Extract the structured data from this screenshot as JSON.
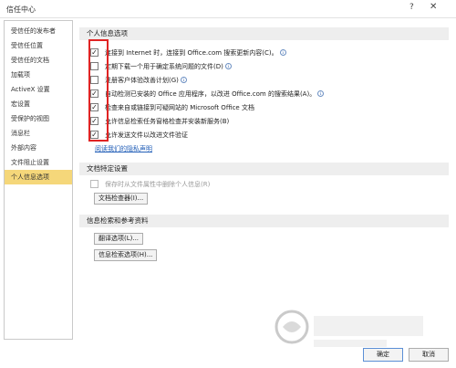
{
  "window": {
    "title": "信任中心",
    "help_glyph": "?",
    "close_glyph": "✕"
  },
  "sidebar": {
    "items": [
      {
        "label": "受信任的发布者"
      },
      {
        "label": "受信任位置"
      },
      {
        "label": "受信任的文档"
      },
      {
        "label": "加载项"
      },
      {
        "label": "ActiveX 设置"
      },
      {
        "label": "宏设置"
      },
      {
        "label": "受保护的视图"
      },
      {
        "label": "消息栏"
      },
      {
        "label": "外部内容"
      },
      {
        "label": "文件阻止设置"
      },
      {
        "label": "个人信息选项"
      }
    ],
    "active_index": 10
  },
  "privacy": {
    "header": "个人信息选项",
    "options": [
      {
        "label": "连接到 Internet 时，连接到 Office.com 搜索更新内容(C)。",
        "checked": true
      },
      {
        "label": "定期下载一个用于确定系统问题的文件(D)",
        "checked": false
      },
      {
        "label": "注册客户体验改善计划(G)",
        "checked": false
      },
      {
        "label": "自动检测已安装的 Office 应用程序，以改进 Office.com 的搜索结果(A)。",
        "checked": true
      },
      {
        "label": "检查来自或链接到可疑网站的 Microsoft Office 文档",
        "checked": true
      },
      {
        "label": "允许信息检索任务窗格检查并安装新服务(B)",
        "checked": true
      },
      {
        "label": "允许发送文件以改进文件验证",
        "checked": true
      }
    ],
    "privacy_link": "阅读我们的隐私声明"
  },
  "doc_specific": {
    "header": "文档特定设置",
    "option": {
      "label": "保存时从文件属性中删除个人信息(R)",
      "checked": false
    },
    "inspector_button": "文档检查器(I)..."
  },
  "research": {
    "header": "信息检索和参考资料",
    "translate_button": "翻译选项(L)...",
    "research_button": "信息检索选项(H)..."
  },
  "footer": {
    "ok_label": "确定",
    "cancel_label": "取消"
  },
  "colors": {
    "active_item": "#f5d77a",
    "highlight_box": "#e02424",
    "link": "#2460b8"
  }
}
